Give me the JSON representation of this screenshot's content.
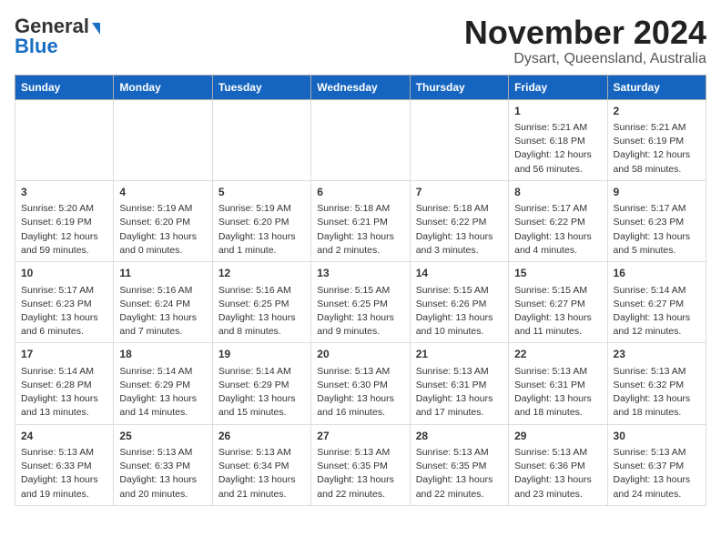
{
  "header": {
    "logo_general": "General",
    "logo_blue": "Blue",
    "month": "November 2024",
    "location": "Dysart, Queensland, Australia"
  },
  "weekdays": [
    "Sunday",
    "Monday",
    "Tuesday",
    "Wednesday",
    "Thursday",
    "Friday",
    "Saturday"
  ],
  "weeks": [
    [
      {
        "day": "",
        "info": ""
      },
      {
        "day": "",
        "info": ""
      },
      {
        "day": "",
        "info": ""
      },
      {
        "day": "",
        "info": ""
      },
      {
        "day": "",
        "info": ""
      },
      {
        "day": "1",
        "info": "Sunrise: 5:21 AM\nSunset: 6:18 PM\nDaylight: 12 hours and 56 minutes."
      },
      {
        "day": "2",
        "info": "Sunrise: 5:21 AM\nSunset: 6:19 PM\nDaylight: 12 hours and 58 minutes."
      }
    ],
    [
      {
        "day": "3",
        "info": "Sunrise: 5:20 AM\nSunset: 6:19 PM\nDaylight: 12 hours and 59 minutes."
      },
      {
        "day": "4",
        "info": "Sunrise: 5:19 AM\nSunset: 6:20 PM\nDaylight: 13 hours and 0 minutes."
      },
      {
        "day": "5",
        "info": "Sunrise: 5:19 AM\nSunset: 6:20 PM\nDaylight: 13 hours and 1 minute."
      },
      {
        "day": "6",
        "info": "Sunrise: 5:18 AM\nSunset: 6:21 PM\nDaylight: 13 hours and 2 minutes."
      },
      {
        "day": "7",
        "info": "Sunrise: 5:18 AM\nSunset: 6:22 PM\nDaylight: 13 hours and 3 minutes."
      },
      {
        "day": "8",
        "info": "Sunrise: 5:17 AM\nSunset: 6:22 PM\nDaylight: 13 hours and 4 minutes."
      },
      {
        "day": "9",
        "info": "Sunrise: 5:17 AM\nSunset: 6:23 PM\nDaylight: 13 hours and 5 minutes."
      }
    ],
    [
      {
        "day": "10",
        "info": "Sunrise: 5:17 AM\nSunset: 6:23 PM\nDaylight: 13 hours and 6 minutes."
      },
      {
        "day": "11",
        "info": "Sunrise: 5:16 AM\nSunset: 6:24 PM\nDaylight: 13 hours and 7 minutes."
      },
      {
        "day": "12",
        "info": "Sunrise: 5:16 AM\nSunset: 6:25 PM\nDaylight: 13 hours and 8 minutes."
      },
      {
        "day": "13",
        "info": "Sunrise: 5:15 AM\nSunset: 6:25 PM\nDaylight: 13 hours and 9 minutes."
      },
      {
        "day": "14",
        "info": "Sunrise: 5:15 AM\nSunset: 6:26 PM\nDaylight: 13 hours and 10 minutes."
      },
      {
        "day": "15",
        "info": "Sunrise: 5:15 AM\nSunset: 6:27 PM\nDaylight: 13 hours and 11 minutes."
      },
      {
        "day": "16",
        "info": "Sunrise: 5:14 AM\nSunset: 6:27 PM\nDaylight: 13 hours and 12 minutes."
      }
    ],
    [
      {
        "day": "17",
        "info": "Sunrise: 5:14 AM\nSunset: 6:28 PM\nDaylight: 13 hours and 13 minutes."
      },
      {
        "day": "18",
        "info": "Sunrise: 5:14 AM\nSunset: 6:29 PM\nDaylight: 13 hours and 14 minutes."
      },
      {
        "day": "19",
        "info": "Sunrise: 5:14 AM\nSunset: 6:29 PM\nDaylight: 13 hours and 15 minutes."
      },
      {
        "day": "20",
        "info": "Sunrise: 5:13 AM\nSunset: 6:30 PM\nDaylight: 13 hours and 16 minutes."
      },
      {
        "day": "21",
        "info": "Sunrise: 5:13 AM\nSunset: 6:31 PM\nDaylight: 13 hours and 17 minutes."
      },
      {
        "day": "22",
        "info": "Sunrise: 5:13 AM\nSunset: 6:31 PM\nDaylight: 13 hours and 18 minutes."
      },
      {
        "day": "23",
        "info": "Sunrise: 5:13 AM\nSunset: 6:32 PM\nDaylight: 13 hours and 18 minutes."
      }
    ],
    [
      {
        "day": "24",
        "info": "Sunrise: 5:13 AM\nSunset: 6:33 PM\nDaylight: 13 hours and 19 minutes."
      },
      {
        "day": "25",
        "info": "Sunrise: 5:13 AM\nSunset: 6:33 PM\nDaylight: 13 hours and 20 minutes."
      },
      {
        "day": "26",
        "info": "Sunrise: 5:13 AM\nSunset: 6:34 PM\nDaylight: 13 hours and 21 minutes."
      },
      {
        "day": "27",
        "info": "Sunrise: 5:13 AM\nSunset: 6:35 PM\nDaylight: 13 hours and 22 minutes."
      },
      {
        "day": "28",
        "info": "Sunrise: 5:13 AM\nSunset: 6:35 PM\nDaylight: 13 hours and 22 minutes."
      },
      {
        "day": "29",
        "info": "Sunrise: 5:13 AM\nSunset: 6:36 PM\nDaylight: 13 hours and 23 minutes."
      },
      {
        "day": "30",
        "info": "Sunrise: 5:13 AM\nSunset: 6:37 PM\nDaylight: 13 hours and 24 minutes."
      }
    ]
  ]
}
